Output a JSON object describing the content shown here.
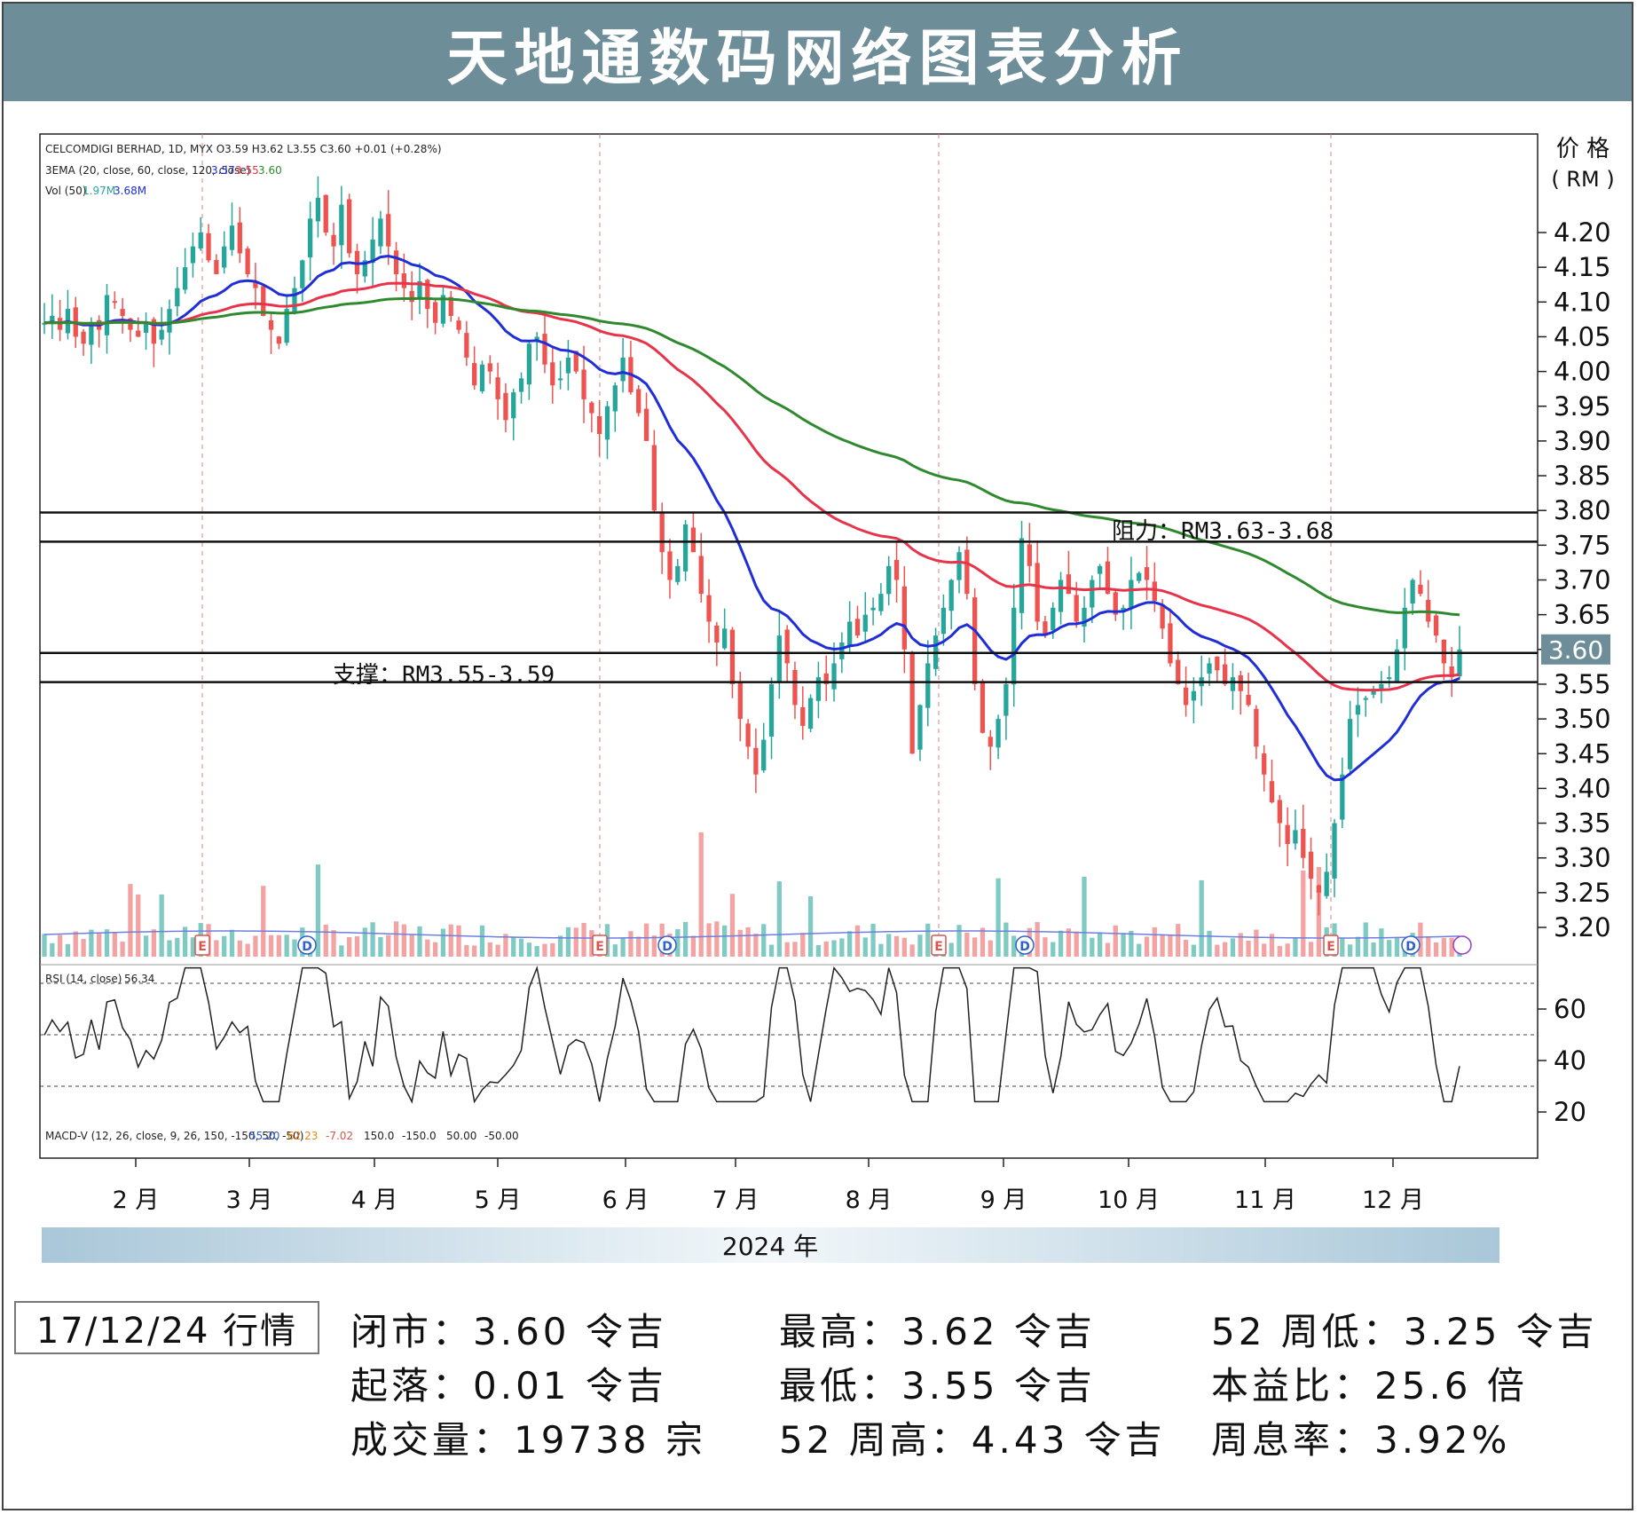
{
  "header": {
    "title": "天地通数码网络图表分析"
  },
  "chart_data": {
    "type": "candlestick",
    "legend_lines": [
      "CELCOMDIGI BERHAD, 1D, MYX  O3.59  H3.62  L3.55  C3.60  +0.01 (+0.28%)",
      "3EMA (20, close, 60, close, 120, close)",
      "Vol (50)"
    ],
    "ema_values": [
      "3.57",
      "3.55",
      "3.60"
    ],
    "vol_values": [
      "1.97M",
      "3.68M"
    ],
    "rsi_label": "RSI (14, close)",
    "rsi_value": "56.34",
    "macd_label": "MACD-V (12, 26, close, 9, 26, 150, -150, 50, -50)",
    "macd_values": [
      "55.20",
      "62.23",
      "-7.02",
      "150.0",
      "-150.0",
      "50.00",
      "-50.00"
    ],
    "price_axis_title": [
      "价 格",
      "( RM )"
    ],
    "price_ticks": [
      "4.20",
      "4.15",
      "4.10",
      "4.05",
      "4.00",
      "3.95",
      "3.90",
      "3.85",
      "3.80",
      "3.75",
      "3.70",
      "3.65",
      "3.60",
      "3.55",
      "3.50",
      "3.45",
      "3.40",
      "3.35",
      "3.30",
      "3.25",
      "3.20"
    ],
    "current_price": "3.60",
    "rsi_ticks": [
      "60",
      "40",
      "20"
    ],
    "months": [
      "2 月",
      "3 月",
      "4 月",
      "5 月",
      "6 月",
      "7 月",
      "8 月",
      "9 月",
      "10 月",
      "11 月",
      "12 月"
    ],
    "year_label": "2024 年",
    "resistance_label": "阻力：RM3.63-3.68",
    "support_label": "支撑：RM3.55-3.59",
    "resistance_zone": [
      3.755,
      3.797
    ],
    "support_zone": [
      3.553,
      3.595
    ],
    "ylim": [
      3.2,
      4.33
    ],
    "rsi_levels": [
      70,
      50,
      30
    ],
    "event_markers": [
      "E",
      "D",
      "E",
      "D",
      "E",
      "D",
      "E",
      "D"
    ],
    "colors": {
      "up": "#26a69a",
      "down": "#ef5350",
      "ema20": "#1f2ed6",
      "ema60": "#e8344a",
      "ema120": "#2f8a2f",
      "vol_ma": "#6f7fe0"
    },
    "close_series": [
      4.07,
      4.08,
      4.06,
      4.09,
      4.05,
      4.04,
      4.07,
      4.06,
      4.11,
      4.1,
      4.08,
      4.06,
      4.05,
      4.07,
      4.04,
      4.06,
      4.09,
      4.12,
      4.15,
      4.18,
      4.2,
      4.16,
      4.14,
      4.18,
      4.21,
      4.17,
      4.14,
      4.12,
      4.08,
      4.06,
      4.04,
      4.09,
      4.12,
      4.16,
      4.22,
      4.25,
      4.2,
      4.18,
      4.24,
      4.17,
      4.14,
      4.16,
      4.19,
      4.22,
      4.18,
      4.14,
      4.12,
      4.1,
      4.13,
      4.09,
      4.07,
      4.11,
      4.08,
      4.06,
      4.02,
      3.98,
      4.01,
      4.0,
      3.96,
      3.93,
      3.97,
      3.99,
      4.04,
      4.05,
      4.01,
      3.98,
      3.99,
      4.02,
      4.0,
      3.96,
      3.94,
      3.91,
      3.95,
      3.98,
      4.02,
      3.97,
      3.94,
      3.9,
      3.8,
      3.74,
      3.7,
      3.72,
      3.78,
      3.74,
      3.68,
      3.64,
      3.61,
      3.63,
      3.55,
      3.5,
      3.46,
      3.42,
      3.47,
      3.55,
      3.62,
      3.58,
      3.52,
      3.49,
      3.53,
      3.56,
      3.55,
      3.58,
      3.61,
      3.64,
      3.62,
      3.65,
      3.66,
      3.68,
      3.72,
      3.7,
      3.6,
      3.45,
      3.52,
      3.58,
      3.62,
      3.66,
      3.7,
      3.74,
      3.68,
      3.55,
      3.48,
      3.46,
      3.5,
      3.55,
      3.66,
      3.76,
      3.72,
      3.64,
      3.62,
      3.66,
      3.7,
      3.68,
      3.64,
      3.66,
      3.7,
      3.72,
      3.68,
      3.65,
      3.66,
      3.7,
      3.71,
      3.7,
      3.67,
      3.63,
      3.58,
      3.55,
      3.52,
      3.54,
      3.56,
      3.58,
      3.57,
      3.55,
      3.56,
      3.54,
      3.52,
      3.46,
      3.42,
      3.38,
      3.35,
      3.32,
      3.34,
      3.3,
      3.27,
      3.25,
      3.28,
      3.35,
      3.42,
      3.5,
      3.52,
      3.53,
      3.54,
      3.55,
      3.56,
      3.6,
      3.66,
      3.7,
      3.68,
      3.64,
      3.62,
      3.58,
      3.56,
      3.6
    ]
  },
  "stats": {
    "date_label": "17/12/24 行情",
    "items": [
      "闭市：3.60 令吉",
      "最高：3.62 令吉",
      "52 周低：3.25 令吉",
      "起落：0.01 令吉",
      "最低：3.55 令吉",
      "本益比：25.6 倍",
      "成交量：19738 宗",
      "52 周高：4.43 令吉",
      "周息率：3.92%"
    ]
  }
}
